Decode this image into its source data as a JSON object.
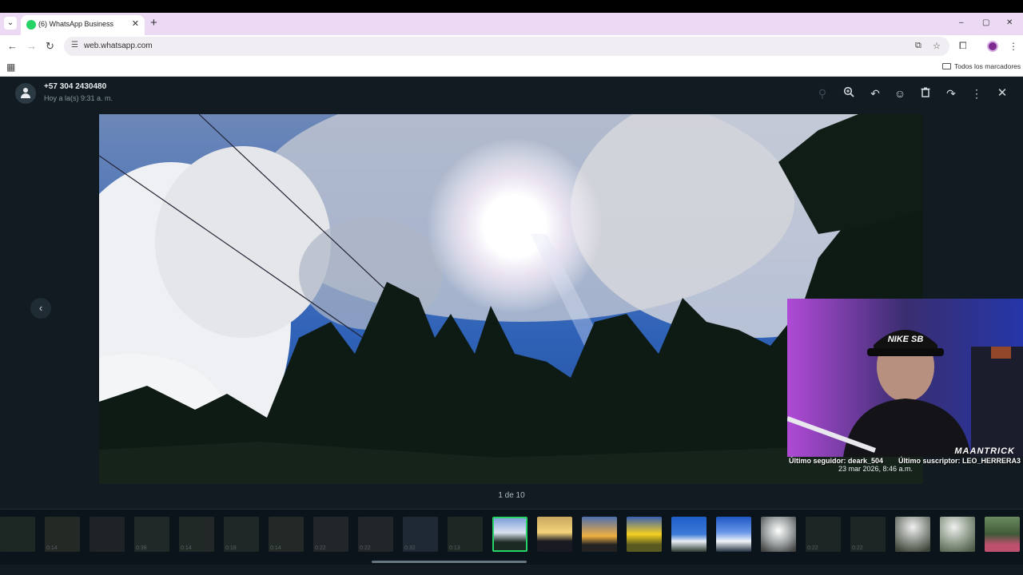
{
  "browser": {
    "tab_title": "(6) WhatsApp Business",
    "tab_close": "✕",
    "new_tab": "+",
    "url": "web.whatsapp.com",
    "bookmarks_folder": "Todos los marcadores",
    "window_controls": [
      "–",
      "▢",
      "✕"
    ]
  },
  "viewer": {
    "contact_name": "+57 304 2430480",
    "timestamp": "Hoy a la(s) 9:31 a. m.",
    "photo_timestamp": "23 mar 2026, 8:46 a.m.",
    "counter": "1 de 10",
    "accent_color": "#25d366",
    "toolbar_icons": [
      "zoom-in-icon",
      "reply-icon",
      "react-icon",
      "delete-icon",
      "forward-icon",
      "more-icon",
      "close-icon"
    ]
  },
  "thumbnails": {
    "durations": [
      "0:14",
      "0:38",
      "0:14",
      "0:18",
      "0:14",
      "0:22",
      "0:22",
      "0:32",
      "0:13",
      "0:22",
      "0:22"
    ]
  },
  "stream_overlay": {
    "logo_text": "MAANTRICK",
    "cap_text": "NIKE SB",
    "last_follower": "Último seguidor: deark_504",
    "last_subscriber": "Último suscriptor: LEO_HERRERA3"
  }
}
